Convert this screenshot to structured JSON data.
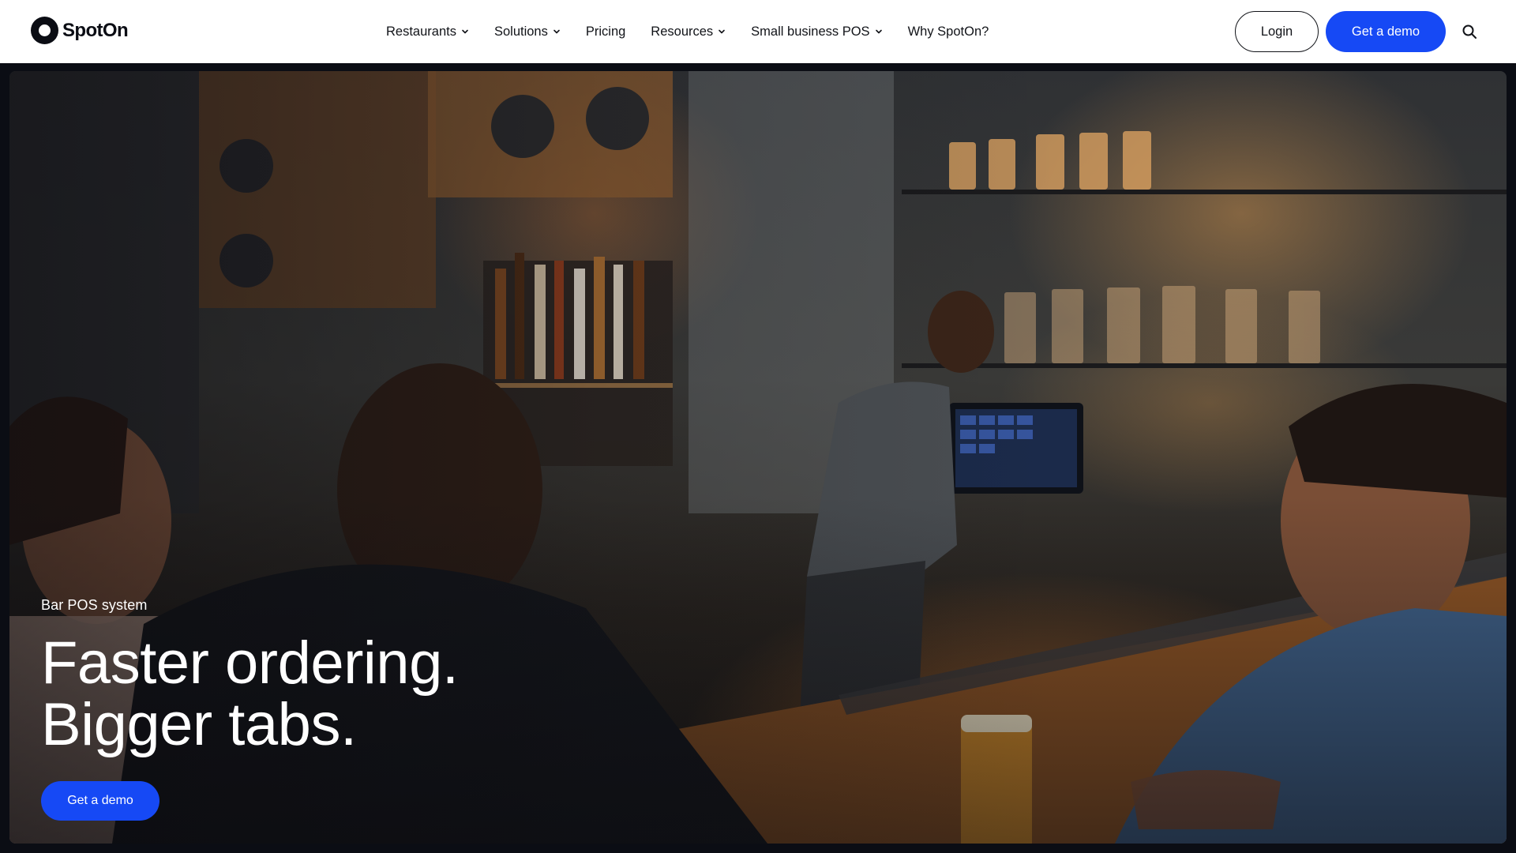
{
  "brand": {
    "name": "SpotOn"
  },
  "nav": {
    "items": [
      {
        "label": "Restaurants",
        "has_dropdown": true
      },
      {
        "label": "Solutions",
        "has_dropdown": true
      },
      {
        "label": "Pricing",
        "has_dropdown": false
      },
      {
        "label": "Resources",
        "has_dropdown": true
      },
      {
        "label": "Small business POS",
        "has_dropdown": true
      },
      {
        "label": "Why SpotOn?",
        "has_dropdown": false
      }
    ],
    "login_label": "Login",
    "demo_label": "Get a demo"
  },
  "hero": {
    "eyebrow": "Bar POS system",
    "headline_line1": "Faster ordering.",
    "headline_line2": "Bigger tabs.",
    "cta_label": "Get a demo"
  },
  "colors": {
    "accent": "#1649f5",
    "text_dark": "#111318",
    "header_bg": "#ffffff"
  },
  "icons": {
    "search": "search-icon",
    "dropdown": "chevron-down-icon",
    "logo": "spoton-logo-icon"
  }
}
